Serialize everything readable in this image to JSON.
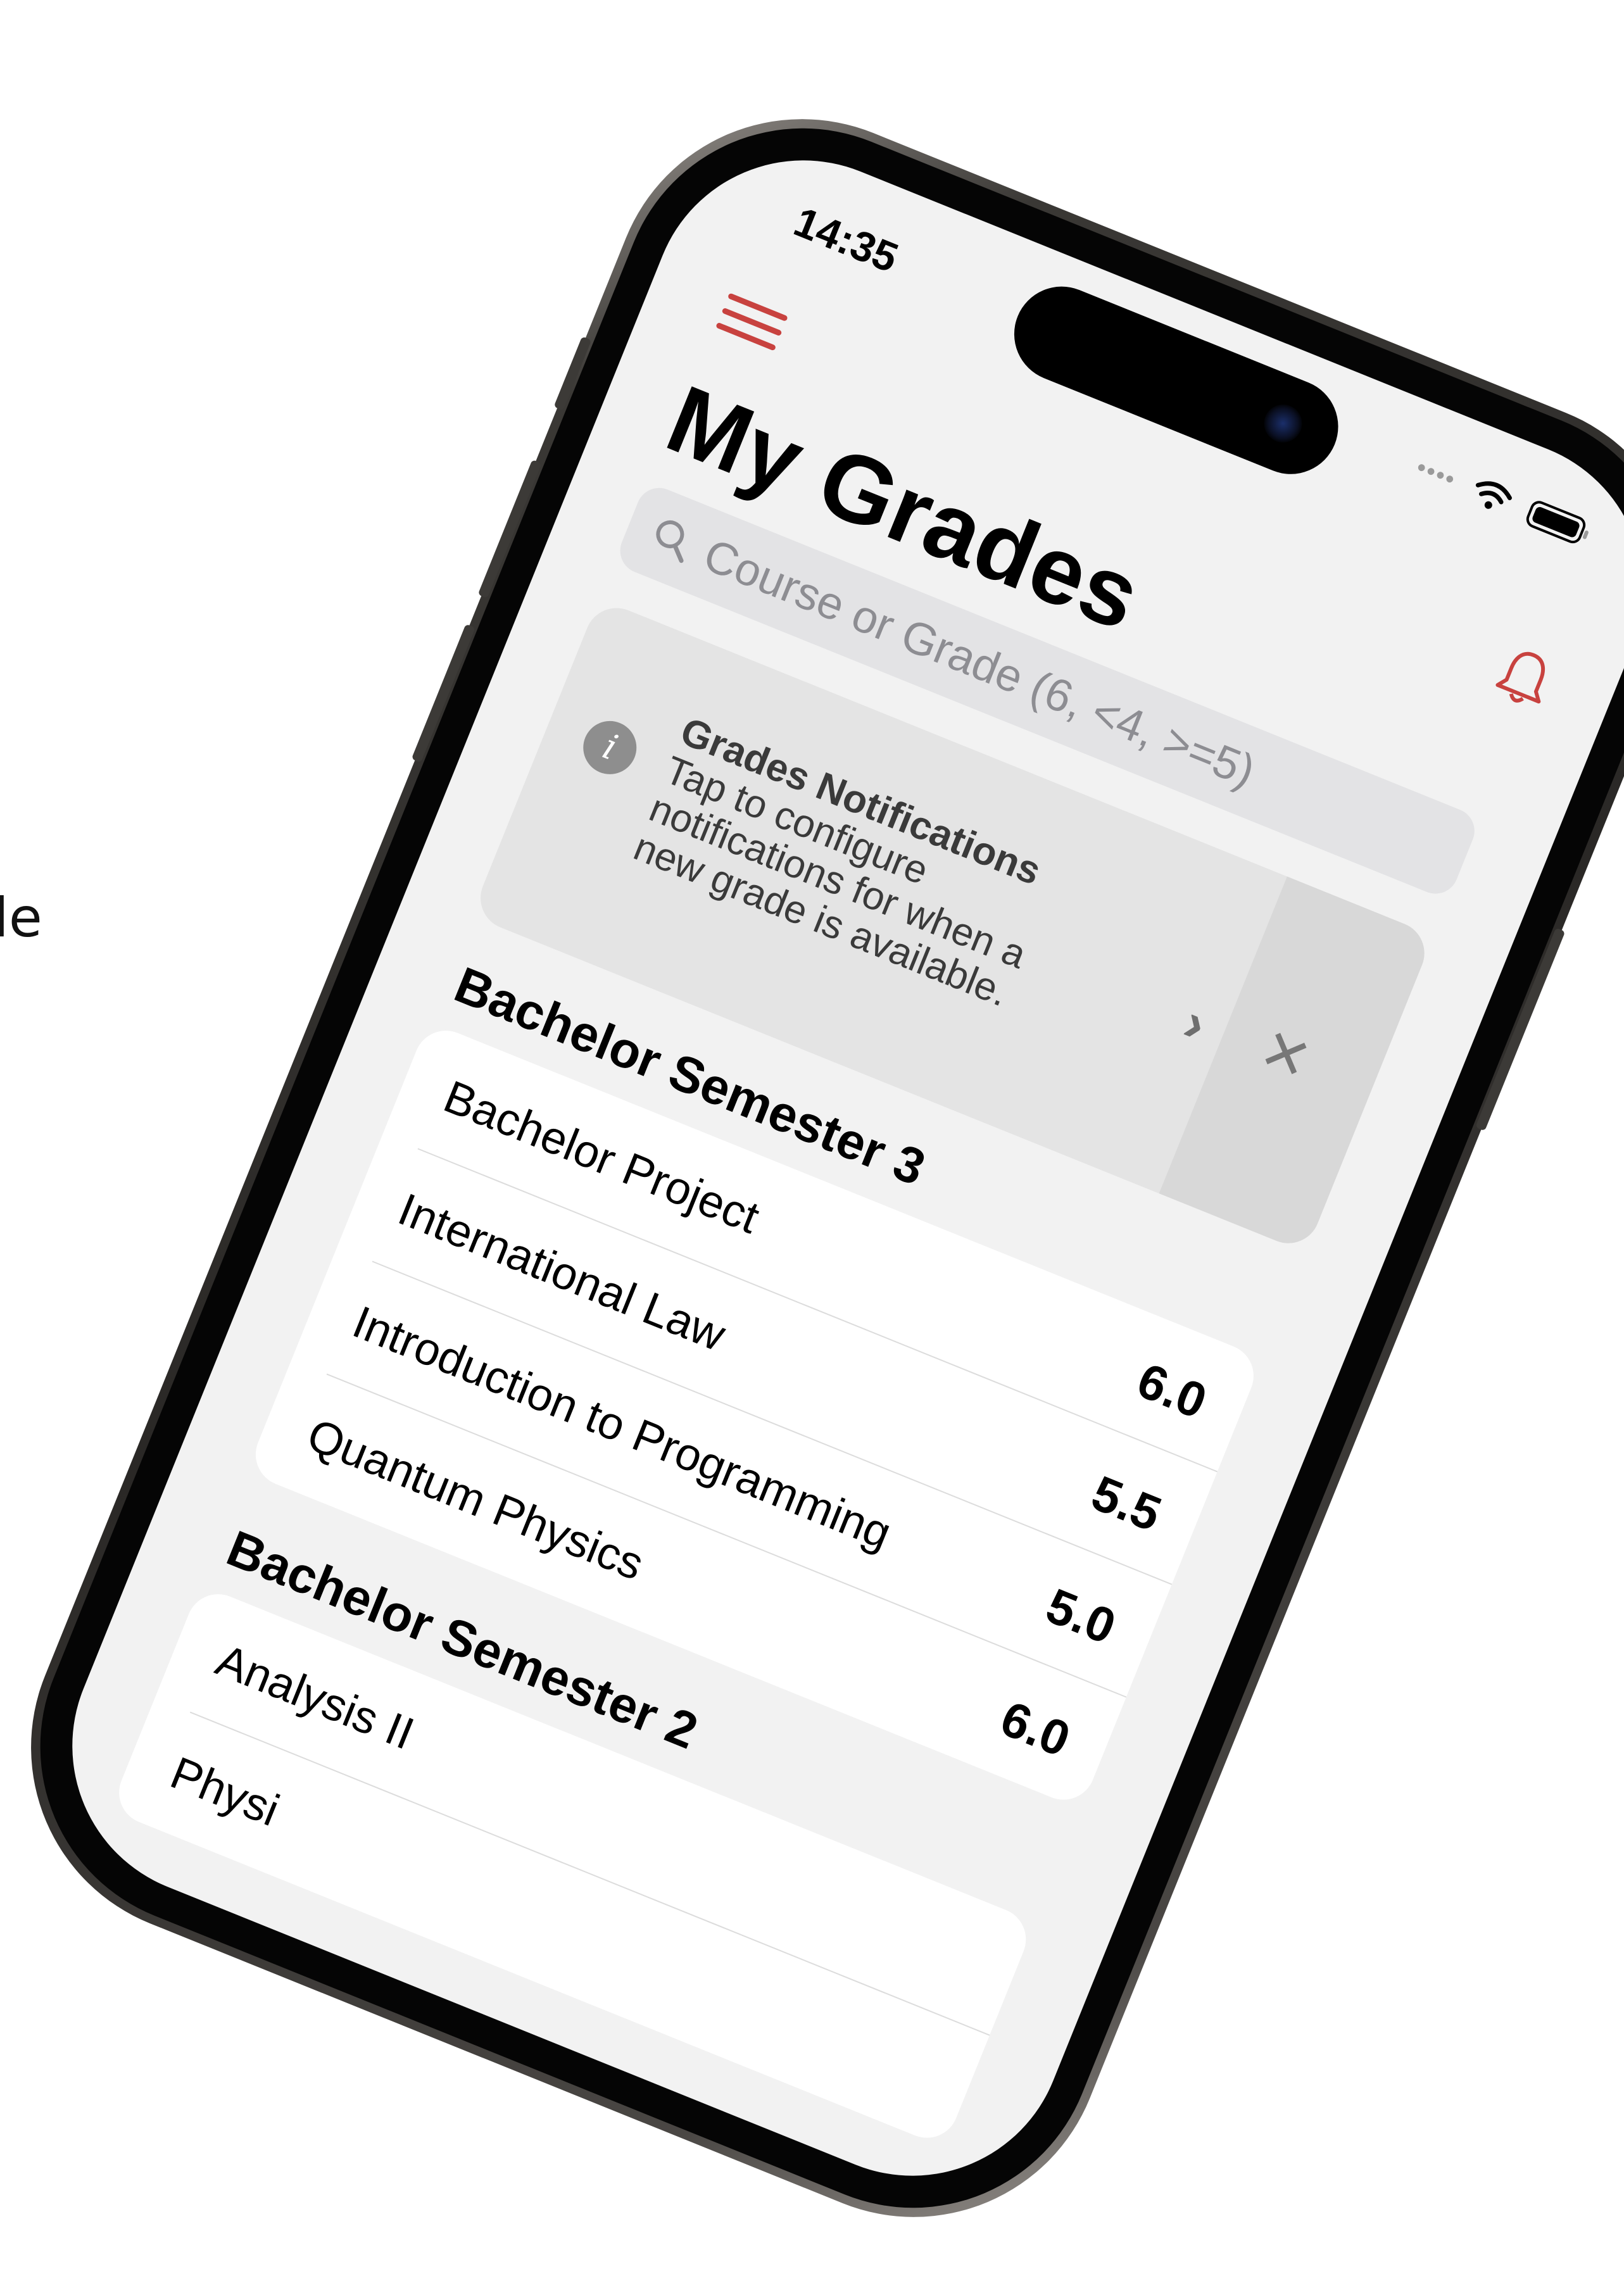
{
  "caption": "le",
  "status_bar": {
    "time": "14:35",
    "dots": "••••"
  },
  "header": {
    "title": "My Grades"
  },
  "search": {
    "placeholder": "Course or Grade (6, <4, >=5)"
  },
  "notice": {
    "title": "Grades Notifications",
    "body": "Tap to configure notifications for when a new grade is available.",
    "chevron": "›",
    "dismiss": "×"
  },
  "sections": [
    {
      "title": "Bachelor Semester 3",
      "courses": [
        {
          "name": "Bachelor Project",
          "grade": "6.0"
        },
        {
          "name": "International Law",
          "grade": "5.5"
        },
        {
          "name": "Introduction to Programming",
          "grade": "5.0"
        },
        {
          "name": "Quantum Physics",
          "grade": "6.0"
        }
      ]
    },
    {
      "title": "Bachelor Semester 2",
      "courses": [
        {
          "name": "Analysis II",
          "grade": ""
        },
        {
          "name": "Physi",
          "grade": ""
        }
      ]
    }
  ],
  "colors": {
    "accent": "#c8423f",
    "background": "#f2f2f2",
    "card": "#ffffff"
  },
  "icons": [
    "hamburger-menu-icon",
    "bell-icon",
    "search-icon",
    "info-icon",
    "wifi-icon",
    "battery-icon",
    "chevron-right-icon",
    "close-icon"
  ]
}
